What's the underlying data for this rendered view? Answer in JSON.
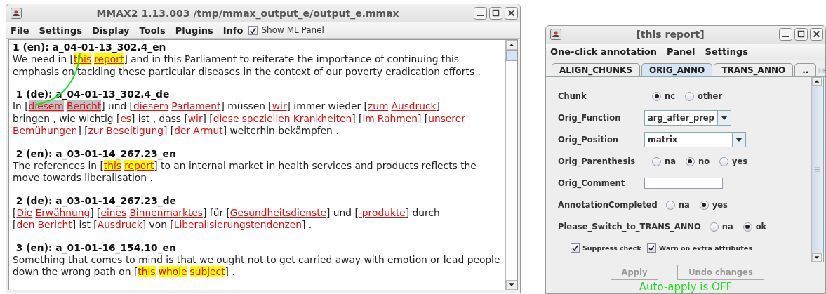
{
  "main_window": {
    "title": "MMAX2 1.13.003 /tmp/mmax_output_e/output_e.mmax",
    "menu": [
      "File",
      "Settings",
      "Display",
      "Tools",
      "Plugins",
      "Info"
    ],
    "show_ml_panel": {
      "label": "Show ML Panel",
      "checked": true
    },
    "sentences": [
      {
        "header": "1 (en): a_04-01-13_302.4_en",
        "lines": [
          [
            {
              "kind": "text",
              "text": "We need in ["
            },
            {
              "kind": "highlight",
              "words": [
                "this",
                "report"
              ]
            },
            {
              "kind": "text",
              "text": "] and in this Parliament to reiterate the importance of continuing this"
            }
          ],
          [
            {
              "kind": "text",
              "text": "emphasis on tackling these particular diseases in the context of our poverty eradication efforts ."
            }
          ]
        ]
      },
      {
        "header": " 1 (de): a_04-01-13_302.4_de",
        "lines": [
          [
            {
              "kind": "text",
              "text": "In ["
            },
            {
              "kind": "selected",
              "words": [
                "diesem",
                "Bericht"
              ]
            },
            {
              "kind": "text",
              "text": "] und ["
            },
            {
              "kind": "markable",
              "words": [
                "diesem",
                "Parlament"
              ]
            },
            {
              "kind": "text",
              "text": "] müssen ["
            },
            {
              "kind": "markable",
              "words": [
                "wir"
              ]
            },
            {
              "kind": "text",
              "text": "] immer wieder ["
            },
            {
              "kind": "markable",
              "words": [
                "zum",
                "Ausdruck"
              ]
            },
            {
              "kind": "text",
              "text": "]"
            }
          ],
          [
            {
              "kind": "text",
              "text": "bringen , wie wichtig ["
            },
            {
              "kind": "markable",
              "words": [
                "es"
              ]
            },
            {
              "kind": "text",
              "text": "] ist , dass ["
            },
            {
              "kind": "markable",
              "words": [
                "wir"
              ]
            },
            {
              "kind": "text",
              "text": "] ["
            },
            {
              "kind": "markable",
              "words": [
                "diese",
                "speziellen",
                "Krankheiten"
              ]
            },
            {
              "kind": "text",
              "text": "] ["
            },
            {
              "kind": "markable",
              "words": [
                "im",
                "Rahmen"
              ]
            },
            {
              "kind": "text",
              "text": "] ["
            },
            {
              "kind": "markable",
              "words": [
                "unserer"
              ]
            }
          ],
          [
            {
              "kind": "markable",
              "words": [
                "Bemühungen"
              ]
            },
            {
              "kind": "text",
              "text": "] ["
            },
            {
              "kind": "markable",
              "words": [
                "zur",
                "Beseitigung"
              ]
            },
            {
              "kind": "text",
              "text": "] ["
            },
            {
              "kind": "markable",
              "words": [
                "der",
                "Armut"
              ]
            },
            {
              "kind": "text",
              "text": "] weiterhin bekämpfen ."
            }
          ]
        ]
      },
      {
        "header": " 2 (en): a_03-01-14_267.23_en",
        "lines": [
          [
            {
              "kind": "text",
              "text": "The references in ["
            },
            {
              "kind": "highlight",
              "words": [
                "this",
                "report"
              ]
            },
            {
              "kind": "text",
              "text": "] to an internal market in health services and products reflects the"
            }
          ],
          [
            {
              "kind": "text",
              "text": "move towards liberalisation ."
            }
          ]
        ]
      },
      {
        "header": " 2 (de): a_03-01-14_267.23_de",
        "lines": [
          [
            {
              "kind": "text",
              "text": "["
            },
            {
              "kind": "markable",
              "words": [
                "Die",
                "Erwähnung"
              ]
            },
            {
              "kind": "text",
              "text": "] ["
            },
            {
              "kind": "markable",
              "words": [
                "eines",
                "Binnenmarktes"
              ]
            },
            {
              "kind": "text",
              "text": "] für ["
            },
            {
              "kind": "markable",
              "words": [
                "Gesundheitsdienste"
              ]
            },
            {
              "kind": "text",
              "text": "] und ["
            },
            {
              "kind": "markable",
              "words": [
                "-produkte"
              ]
            },
            {
              "kind": "text",
              "text": "] durch"
            }
          ],
          [
            {
              "kind": "text",
              "text": "["
            },
            {
              "kind": "markable",
              "words": [
                "den",
                "Bericht"
              ]
            },
            {
              "kind": "text",
              "text": "] ist ["
            },
            {
              "kind": "markable",
              "words": [
                "Ausdruck"
              ]
            },
            {
              "kind": "text",
              "text": "] von ["
            },
            {
              "kind": "markable",
              "words": [
                "Liberalisierungstendenzen"
              ]
            },
            {
              "kind": "text",
              "text": "] ."
            }
          ]
        ]
      },
      {
        "header": " 3 (en): a_01-01-16_154.10_en",
        "lines": [
          [
            {
              "kind": "text",
              "text": "Something that comes to mind is that we ought not to get carried away with emotion or lead people"
            }
          ],
          [
            {
              "kind": "text",
              "text": "down the wrong path on ["
            },
            {
              "kind": "highlight",
              "words": [
                "this",
                "whole",
                "subject"
              ]
            },
            {
              "kind": "text",
              "text": "] ."
            }
          ]
        ]
      }
    ]
  },
  "annotation_window": {
    "title": "[this report]",
    "menu": [
      "One-click annotation",
      "Panel",
      "Settings"
    ],
    "tabs": [
      {
        "label": "ALIGN_CHUNKS",
        "selected": false
      },
      {
        "label": "ORIG_ANNO",
        "selected": true
      },
      {
        "label": "TRANS_ANNO",
        "selected": false
      },
      {
        "label": "..",
        "selected": false
      }
    ],
    "attributes": [
      {
        "kind": "radio",
        "label": "Chunk",
        "options": [
          {
            "label": "nc",
            "selected": true
          },
          {
            "label": "other",
            "selected": false
          }
        ]
      },
      {
        "kind": "dropdown",
        "label": "Orig_Function",
        "value": "arg_after_prep"
      },
      {
        "kind": "dropdown",
        "label": "Orig_Position",
        "value": "matrix"
      },
      {
        "kind": "radio",
        "label": "Orig_Parenthesis",
        "options": [
          {
            "label": "na",
            "selected": false
          },
          {
            "label": "no",
            "selected": true
          },
          {
            "label": "yes",
            "selected": false
          }
        ]
      },
      {
        "kind": "text",
        "label": "Orig_Comment"
      },
      {
        "kind": "radio",
        "label": "AnnotationCompleted",
        "options": [
          {
            "label": "na",
            "selected": false
          },
          {
            "label": "yes",
            "selected": true
          }
        ]
      },
      {
        "kind": "radio",
        "label": "Please_Switch_to_TRANS_ANNO",
        "options": [
          {
            "label": "na",
            "selected": false
          },
          {
            "label": "ok",
            "selected": true
          }
        ]
      }
    ],
    "checkboxes": [
      {
        "label": "Suppress check",
        "checked": true
      },
      {
        "label": "Warn on extra attributes",
        "checked": true
      }
    ],
    "buttons": [
      {
        "label": "Apply",
        "disabled": true
      },
      {
        "label": "Undo changes",
        "disabled": true
      }
    ],
    "status": "Auto-apply is OFF"
  }
}
